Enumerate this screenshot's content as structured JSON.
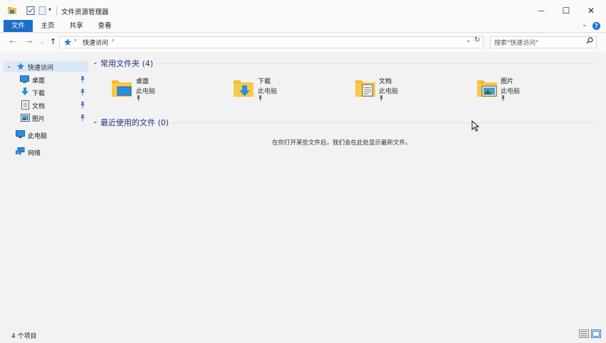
{
  "window": {
    "title": "文件资源管理器",
    "minimize_glyph": "—",
    "maximize_glyph": "☐",
    "close_glyph": "✕"
  },
  "quick_access_toolbar": {
    "icons": [
      "folder-icon",
      "properties-icon",
      "new-folder-icon",
      "customize-dropdown-icon"
    ],
    "dropdown_glyph": "▾"
  },
  "ribbon": {
    "tabs": [
      "文件",
      "主页",
      "共享",
      "查看"
    ],
    "expand_glyph": "⌄",
    "help_glyph": "?"
  },
  "address_bar": {
    "back_glyph": "←",
    "forward_glyph": "→",
    "history_glyph": "⌄",
    "up_glyph": "↑",
    "separator_glyph": "›",
    "path": "快速访问",
    "dropdown_glyph": "⌄",
    "refresh_glyph": "↻"
  },
  "search": {
    "placeholder": "搜索\"快速访问\"",
    "icon_glyph": "⚲"
  },
  "sidebar": {
    "quick_access": "快速访问",
    "items": [
      {
        "label": "桌面",
        "icon": "desktop-icon",
        "pinned": true
      },
      {
        "label": "下载",
        "icon": "download-icon",
        "pinned": true
      },
      {
        "label": "文档",
        "icon": "document-icon",
        "pinned": true
      },
      {
        "label": "图片",
        "icon": "pictures-icon",
        "pinned": true
      }
    ],
    "this_pc": "此电脑",
    "network": "网络",
    "pin_glyph": "📌"
  },
  "frequent_folders": {
    "heading": "常用文件夹 (4)",
    "chevron_glyph": "⌄",
    "folders": [
      {
        "name": "桌面",
        "location": "此电脑",
        "icon": "desktop-folder-icon"
      },
      {
        "name": "下载",
        "location": "此电脑",
        "icon": "download-folder-icon"
      },
      {
        "name": "文档",
        "location": "此电脑",
        "icon": "document-folder-icon"
      },
      {
        "name": "图片",
        "location": "此电脑",
        "icon": "pictures-folder-icon"
      }
    ],
    "pin_glyph": "📌"
  },
  "recent_files": {
    "heading": "最近使用的文件 (0)",
    "chevron_glyph": "⌄",
    "empty_message": "在你打开某些文件后，我们会在此处显示最新文件。"
  },
  "status_bar": {
    "item_count": "4 个项目"
  },
  "colors": {
    "accent": "#1a6ec9",
    "heading": "#1e3287",
    "folder_yellow": "#f7c23a",
    "selection": "#d9e8f7"
  }
}
